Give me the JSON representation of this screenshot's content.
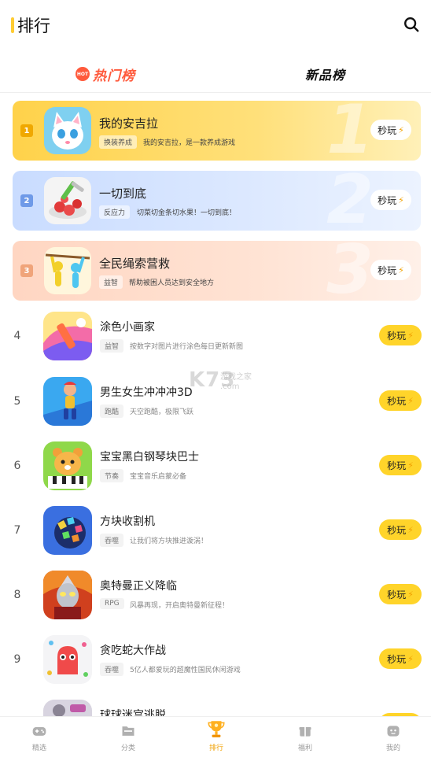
{
  "header": {
    "title": "排行",
    "search_icon": "search-icon"
  },
  "tabs": [
    {
      "label": "热门榜",
      "badge": "HOT",
      "active": true
    },
    {
      "label": "新品榜",
      "active": false
    }
  ],
  "top_cards": [
    {
      "rank": "1",
      "name": "我的安吉拉",
      "tag": "换装养成",
      "desc": "我的安吉拉，是一款养成游戏",
      "button": "秒玩"
    },
    {
      "rank": "2",
      "name": "一切到底",
      "tag": "反应力",
      "desc": "切菜切金条切水果！一切到底！",
      "button": "秒玩"
    },
    {
      "rank": "3",
      "name": "全民绳索营救",
      "tag": "益智",
      "desc": "帮助被困人员达到安全地方",
      "button": "秒玩"
    }
  ],
  "list": [
    {
      "rank": "4",
      "name": "涂色小画家",
      "tag": "益智",
      "desc": "按数字对图片进行涂色每日更新新图",
      "button": "秒玩"
    },
    {
      "rank": "5",
      "name": "男生女生冲冲冲3D",
      "tag": "跑酷",
      "desc": "天空跑酷，极限飞跃",
      "button": "秒玩"
    },
    {
      "rank": "6",
      "name": "宝宝黑白钢琴块巴士",
      "tag": "节奏",
      "desc": "宝宝音乐启蒙必备",
      "button": "秒玩"
    },
    {
      "rank": "7",
      "name": "方块收割机",
      "tag": "吞噬",
      "desc": "让我们将方块推进漩涡！",
      "button": "秒玩"
    },
    {
      "rank": "8",
      "name": "奥特曼正义降临",
      "tag": "RPG",
      "desc": "风暴再现，开启奥特曼新征程！",
      "button": "秒玩"
    },
    {
      "rank": "9",
      "name": "贪吃蛇大作战",
      "tag": "吞噬",
      "desc": "5亿人都爱玩的超魔性国民休闲游戏",
      "button": "秒玩"
    },
    {
      "rank": "",
      "name": "球球迷宫逃脱",
      "tag": "",
      "desc": "",
      "button": ""
    }
  ],
  "watermark": {
    "logo": "K73",
    "text": "游戏之家",
    "url": ".com"
  },
  "bottom_nav": [
    {
      "label": "精选",
      "icon": "gamepad-icon",
      "active": false
    },
    {
      "label": "分类",
      "icon": "folder-icon",
      "active": false
    },
    {
      "label": "排行",
      "icon": "trophy-icon",
      "active": true
    },
    {
      "label": "福利",
      "icon": "gift-icon",
      "active": false
    },
    {
      "label": "我的",
      "icon": "profile-icon",
      "active": false
    }
  ],
  "colors": {
    "accent": "#ffd42a",
    "hot": "#ff5a3c",
    "active_nav": "#f0a000"
  }
}
